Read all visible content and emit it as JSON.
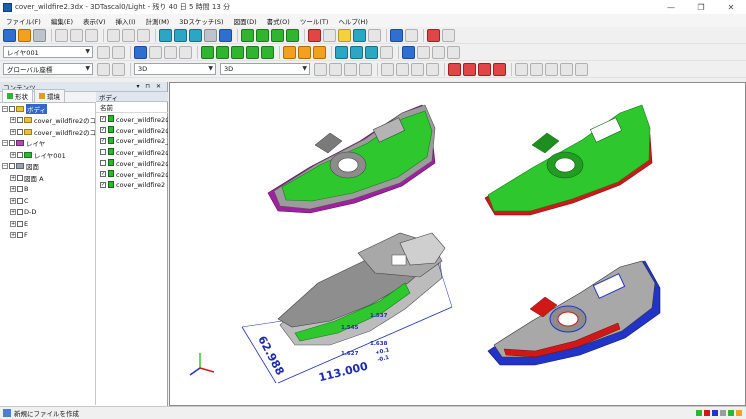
{
  "window": {
    "title": "cover_wildfire2.3dx - 3DTascal0/Light - 残り 40 日 5 時間 13 分",
    "minimize": "—",
    "maximize": "❐",
    "close": "✕"
  },
  "menu": [
    "ファイル(F)",
    "編集(E)",
    "表示(V)",
    "挿入(I)",
    "計測(M)",
    "3Dスケッチ(S)",
    "図面(D)",
    "書式(O)",
    "ツール(T)",
    "ヘルプ(H)"
  ],
  "toolbar": {
    "layer_combo": "レイヤ001",
    "coord_combo": "グローバル座標",
    "view_combo_1": "3D",
    "view_combo_2": "3D"
  },
  "contents": {
    "title": "コンテンツ",
    "pin": "▾ ⊓ ✕",
    "tabs": [
      "形状",
      "環境"
    ],
    "tree": [
      {
        "label": "ボディ",
        "level": 0,
        "expander": "−"
      },
      {
        "label": "cover_wildfire2のコピ",
        "level": 1,
        "expander": "+"
      },
      {
        "label": "cover_wildfire2のコピ",
        "level": 1,
        "expander": "+"
      },
      {
        "label": "レイヤ",
        "level": 0,
        "expander": "−"
      },
      {
        "label": "レイヤ001",
        "level": 1,
        "expander": "+"
      },
      {
        "label": "図面",
        "level": 0,
        "expander": "−"
      },
      {
        "label": "図面 A",
        "level": 1,
        "expander": "+"
      },
      {
        "label": "B",
        "level": 1,
        "expander": "+"
      },
      {
        "label": "C",
        "level": 1,
        "expander": "+"
      },
      {
        "label": "D-D",
        "level": 1,
        "expander": "+"
      },
      {
        "label": "E",
        "level": 1,
        "expander": "+"
      },
      {
        "label": "F",
        "level": 1,
        "expander": "+"
      }
    ]
  },
  "body_panel": {
    "title": "ボディ",
    "column_header": "名前",
    "rows": [
      {
        "label": "cover_wildfire2の",
        "checked": true
      },
      {
        "label": "cover_wildfire2の",
        "checked": true
      },
      {
        "label": "cover_wildfire2_8",
        "checked": true
      },
      {
        "label": "cover_wildfire2の",
        "checked": false
      },
      {
        "label": "cover_wildfire2の",
        "checked": false
      },
      {
        "label": "cover_wildfire2の",
        "checked": true
      },
      {
        "label": "cover_wildfire2",
        "checked": true
      }
    ]
  },
  "viewport": {
    "dimensions": {
      "length_value": "113.000",
      "length_tol_upper": "+0.1",
      "length_tol_lower": "-0.1",
      "width_value": "62.988",
      "small_1": "1.545",
      "small_2": "1.537",
      "small_3": "1.627",
      "small_4": "1.638"
    },
    "colors": {
      "green": "#2ec82e",
      "gray": "#9c9c9c",
      "magenta": "#a020a0",
      "red": "#d01818",
      "blue": "#2233c8",
      "dimension": "#1a2bb0"
    }
  },
  "status": {
    "message": "新規にファイルを作成"
  }
}
